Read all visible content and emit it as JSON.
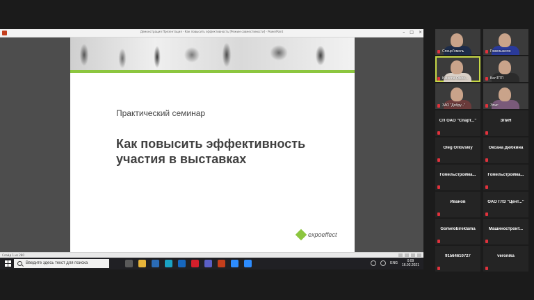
{
  "window": {
    "title": "Демонстрация Презентация - Как повысить эффективность [Режим совместимости] - PowerPoint",
    "controls": [
      "–",
      "□",
      "×"
    ]
  },
  "slide": {
    "subtitle": "Практический семинар",
    "headline": "Как повысить эффективность участия в выставках",
    "logo": "expoeffect",
    "accent_color": "#8cc63f"
  },
  "status_bar": {
    "slide_counter": "Слайд 1 из 280"
  },
  "taskbar": {
    "search_placeholder": "Введите здесь текст для поиска",
    "language": "ENG",
    "time": "0:09",
    "date": "16.02.2021",
    "apps": [
      {
        "icon": "task-view-icon",
        "color": "#5a5a5a"
      },
      {
        "icon": "file-explorer-icon",
        "color": "#e8b43a"
      },
      {
        "icon": "store-icon",
        "color": "#2b6cb8"
      },
      {
        "icon": "edge-icon",
        "color": "#1aa3c4"
      },
      {
        "icon": "outlook-icon",
        "color": "#1667c0"
      },
      {
        "icon": "opera-icon",
        "color": "#d41f2c"
      },
      {
        "icon": "teams-icon",
        "color": "#5b5fc7"
      },
      {
        "icon": "powerpoint-icon",
        "color": "#c43e1c"
      },
      {
        "icon": "zoom-app-icon",
        "color": "#2d8cff"
      },
      {
        "icon": "zoom-meeting-icon",
        "color": "#2d8cff"
      }
    ]
  },
  "participants": [
    {
      "name": "СпецоГомель",
      "video": true,
      "shirt": "#1d2c4a"
    },
    {
      "name": "Гомельэкспо",
      "video": true,
      "shirt": "#2a3a9a"
    },
    {
      "name": "Katerina Olshe...",
      "video": true,
      "active": true,
      "shirt": "#d9d0c7"
    },
    {
      "name": "БелТПП",
      "video": true,
      "shirt": "#2b2b2b"
    },
    {
      "name": "ЗАО \"Добру...\"",
      "video": true,
      "shirt": "#6b3b3b"
    },
    {
      "name": "Элис",
      "video": true,
      "shirt": "#7a5a7a"
    },
    {
      "name": "СП ОАО \"Спарт...\"",
      "video": false
    },
    {
      "name": "ЗЛиН",
      "video": false
    },
    {
      "name": "Oleg Orlovskiy",
      "video": false
    },
    {
      "name": "Оксана Дюбкина",
      "video": false
    },
    {
      "name": "Гомельстройма...",
      "video": false
    },
    {
      "name": "Гомельстройма...",
      "video": false
    },
    {
      "name": "Иванов",
      "video": false
    },
    {
      "name": "ОАО ГЛЗ \"Цент...\"",
      "video": false
    },
    {
      "name": "Gomelobireklama",
      "video": false
    },
    {
      "name": "Машиностроит...",
      "video": false
    },
    {
      "name": "91564610727",
      "video": false
    },
    {
      "name": "veronika",
      "video": false
    }
  ]
}
